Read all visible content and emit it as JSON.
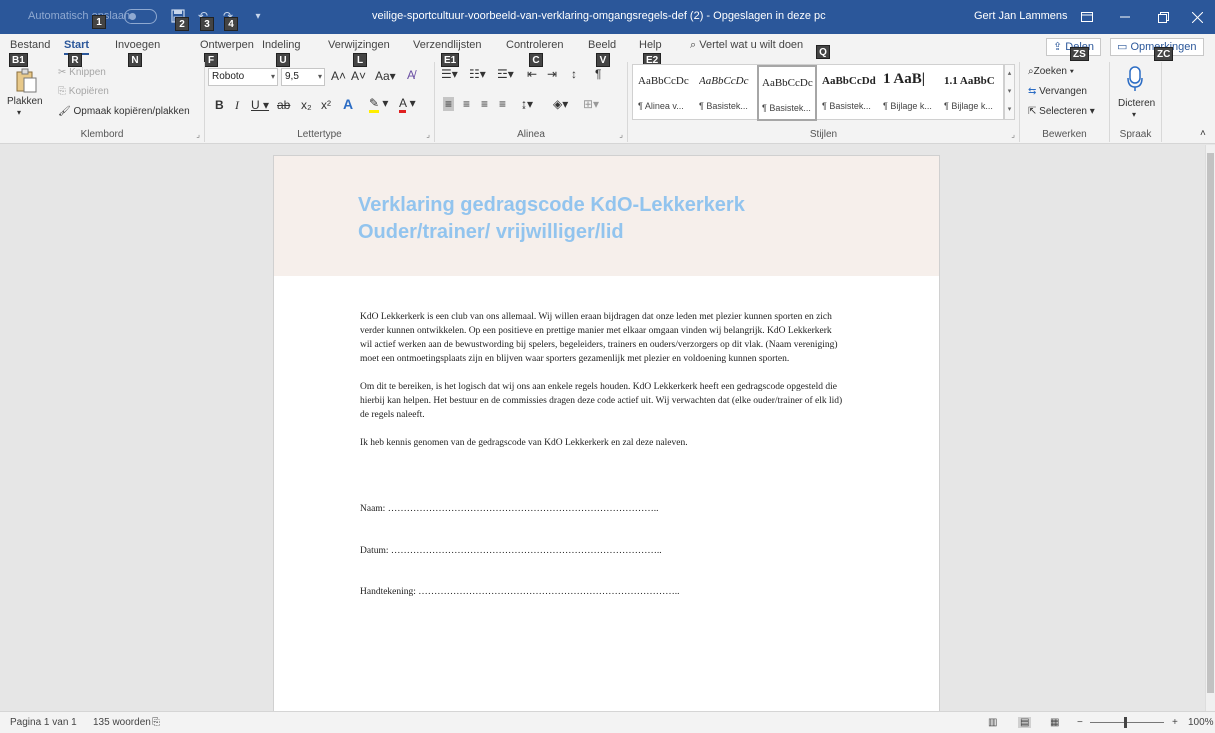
{
  "titlebar": {
    "autosave_label": "Automatisch opslaan",
    "autosave_state": "off",
    "doc_title": "veilige-sportcultuur-voorbeeld-van-verklaring-omgangsregels-def (2) - Opgeslagen in deze pc",
    "user": "Gert Jan Lammens",
    "keytips": [
      "1",
      "2",
      "3",
      "4"
    ],
    "brand_color": "#2b579a"
  },
  "tabs": [
    {
      "label": "Bestand",
      "keytip": "B1"
    },
    {
      "label": "Start",
      "keytip": "R"
    },
    {
      "label": "Invoegen",
      "keytip": "N"
    },
    {
      "label": "Ontwerpen",
      "keytip": "F"
    },
    {
      "label": "Indeling",
      "keytip": "U"
    },
    {
      "label": "Verwijzingen",
      "keytip": "L"
    },
    {
      "label": "Verzendlijsten",
      "keytip": "E1"
    },
    {
      "label": "Controleren",
      "keytip": "C"
    },
    {
      "label": "Beeld",
      "keytip": "V"
    },
    {
      "label": "Help",
      "keytip": "E2"
    }
  ],
  "tellme": {
    "label": "Vertel wat u wilt doen",
    "keytip": "Q"
  },
  "share": {
    "label": "Delen",
    "keytip": "ZS"
  },
  "comments": {
    "label": "Opmerkingen",
    "keytip": "ZC"
  },
  "clipboard": {
    "paste": "Plakken",
    "cut": "Knippen",
    "copy": "Kopiëren",
    "format_painter": "Opmaak kopiëren/plakken",
    "group": "Klembord"
  },
  "font": {
    "family": "Roboto",
    "size": "9,5",
    "group": "Lettertype"
  },
  "paragraph": {
    "group": "Alinea"
  },
  "styles": {
    "group": "Stijlen",
    "items": [
      {
        "sample": "AaBbCcDc",
        "name": "¶ Alinea v..."
      },
      {
        "sample": "AaBbCcDc",
        "name": "¶ Basistek..."
      },
      {
        "sample": "AaBbCcDc",
        "name": "¶ Basistek..."
      },
      {
        "sample": "AaBbCcDd",
        "name": "¶ Basistek..."
      },
      {
        "sample": "1 AaB|",
        "name": "¶ Bijlage k..."
      },
      {
        "sample": "1.1 AaBbC",
        "name": "¶ Bijlage k..."
      }
    ]
  },
  "editing": {
    "find": "Zoeken",
    "replace": "Vervangen",
    "select": "Selecteren",
    "group": "Bewerken"
  },
  "voice": {
    "dictate": "Dicteren",
    "group": "Spraak"
  },
  "document": {
    "title_line1": "Verklaring gedragscode KdO-Lekkerkerk",
    "title_line2": "Ouder/trainer/ vrijwilliger/lid",
    "title_color": "#92c4ee",
    "para1": "KdO Lekkerkerk is een club van ons allemaal. Wij willen eraan bijdragen dat onze leden met plezier kunnen sporten en zich verder kunnen ontwikkelen. Op een positieve en prettige manier met elkaar omgaan vinden wij belangrijk. KdO Lekkerkerk wil actief werken aan de bewustwording bij spelers, begeleiders, trainers en ouders/verzorgers op dit vlak. (Naam vereniging) moet een ontmoetingsplaats zijn en blijven waar sporters gezamenlijk met plezier en voldoening kunnen sporten.",
    "para2": "Om dit te bereiken, is het logisch dat wij ons aan enkele regels houden. KdO Lekkerkerk heeft een gedragscode opgesteld die hierbij kan helpen. Het bestuur en de commissies dragen deze code actief uit. Wij verwachten dat (elke ouder/trainer of elk lid) de regels naleeft.",
    "para3": "Ik heb kennis genomen van de gedragscode van KdO Lekkerkerk en zal deze naleven.",
    "naam": "Naam: …………………………………………………………………………..",
    "datum": "Datum: …………………………………………………………………………..",
    "handtekening": "Handtekening: ……………………………………………………………………….."
  },
  "status": {
    "page": "Pagina 1 van 1",
    "words": "135 woorden",
    "zoom": "100%"
  }
}
